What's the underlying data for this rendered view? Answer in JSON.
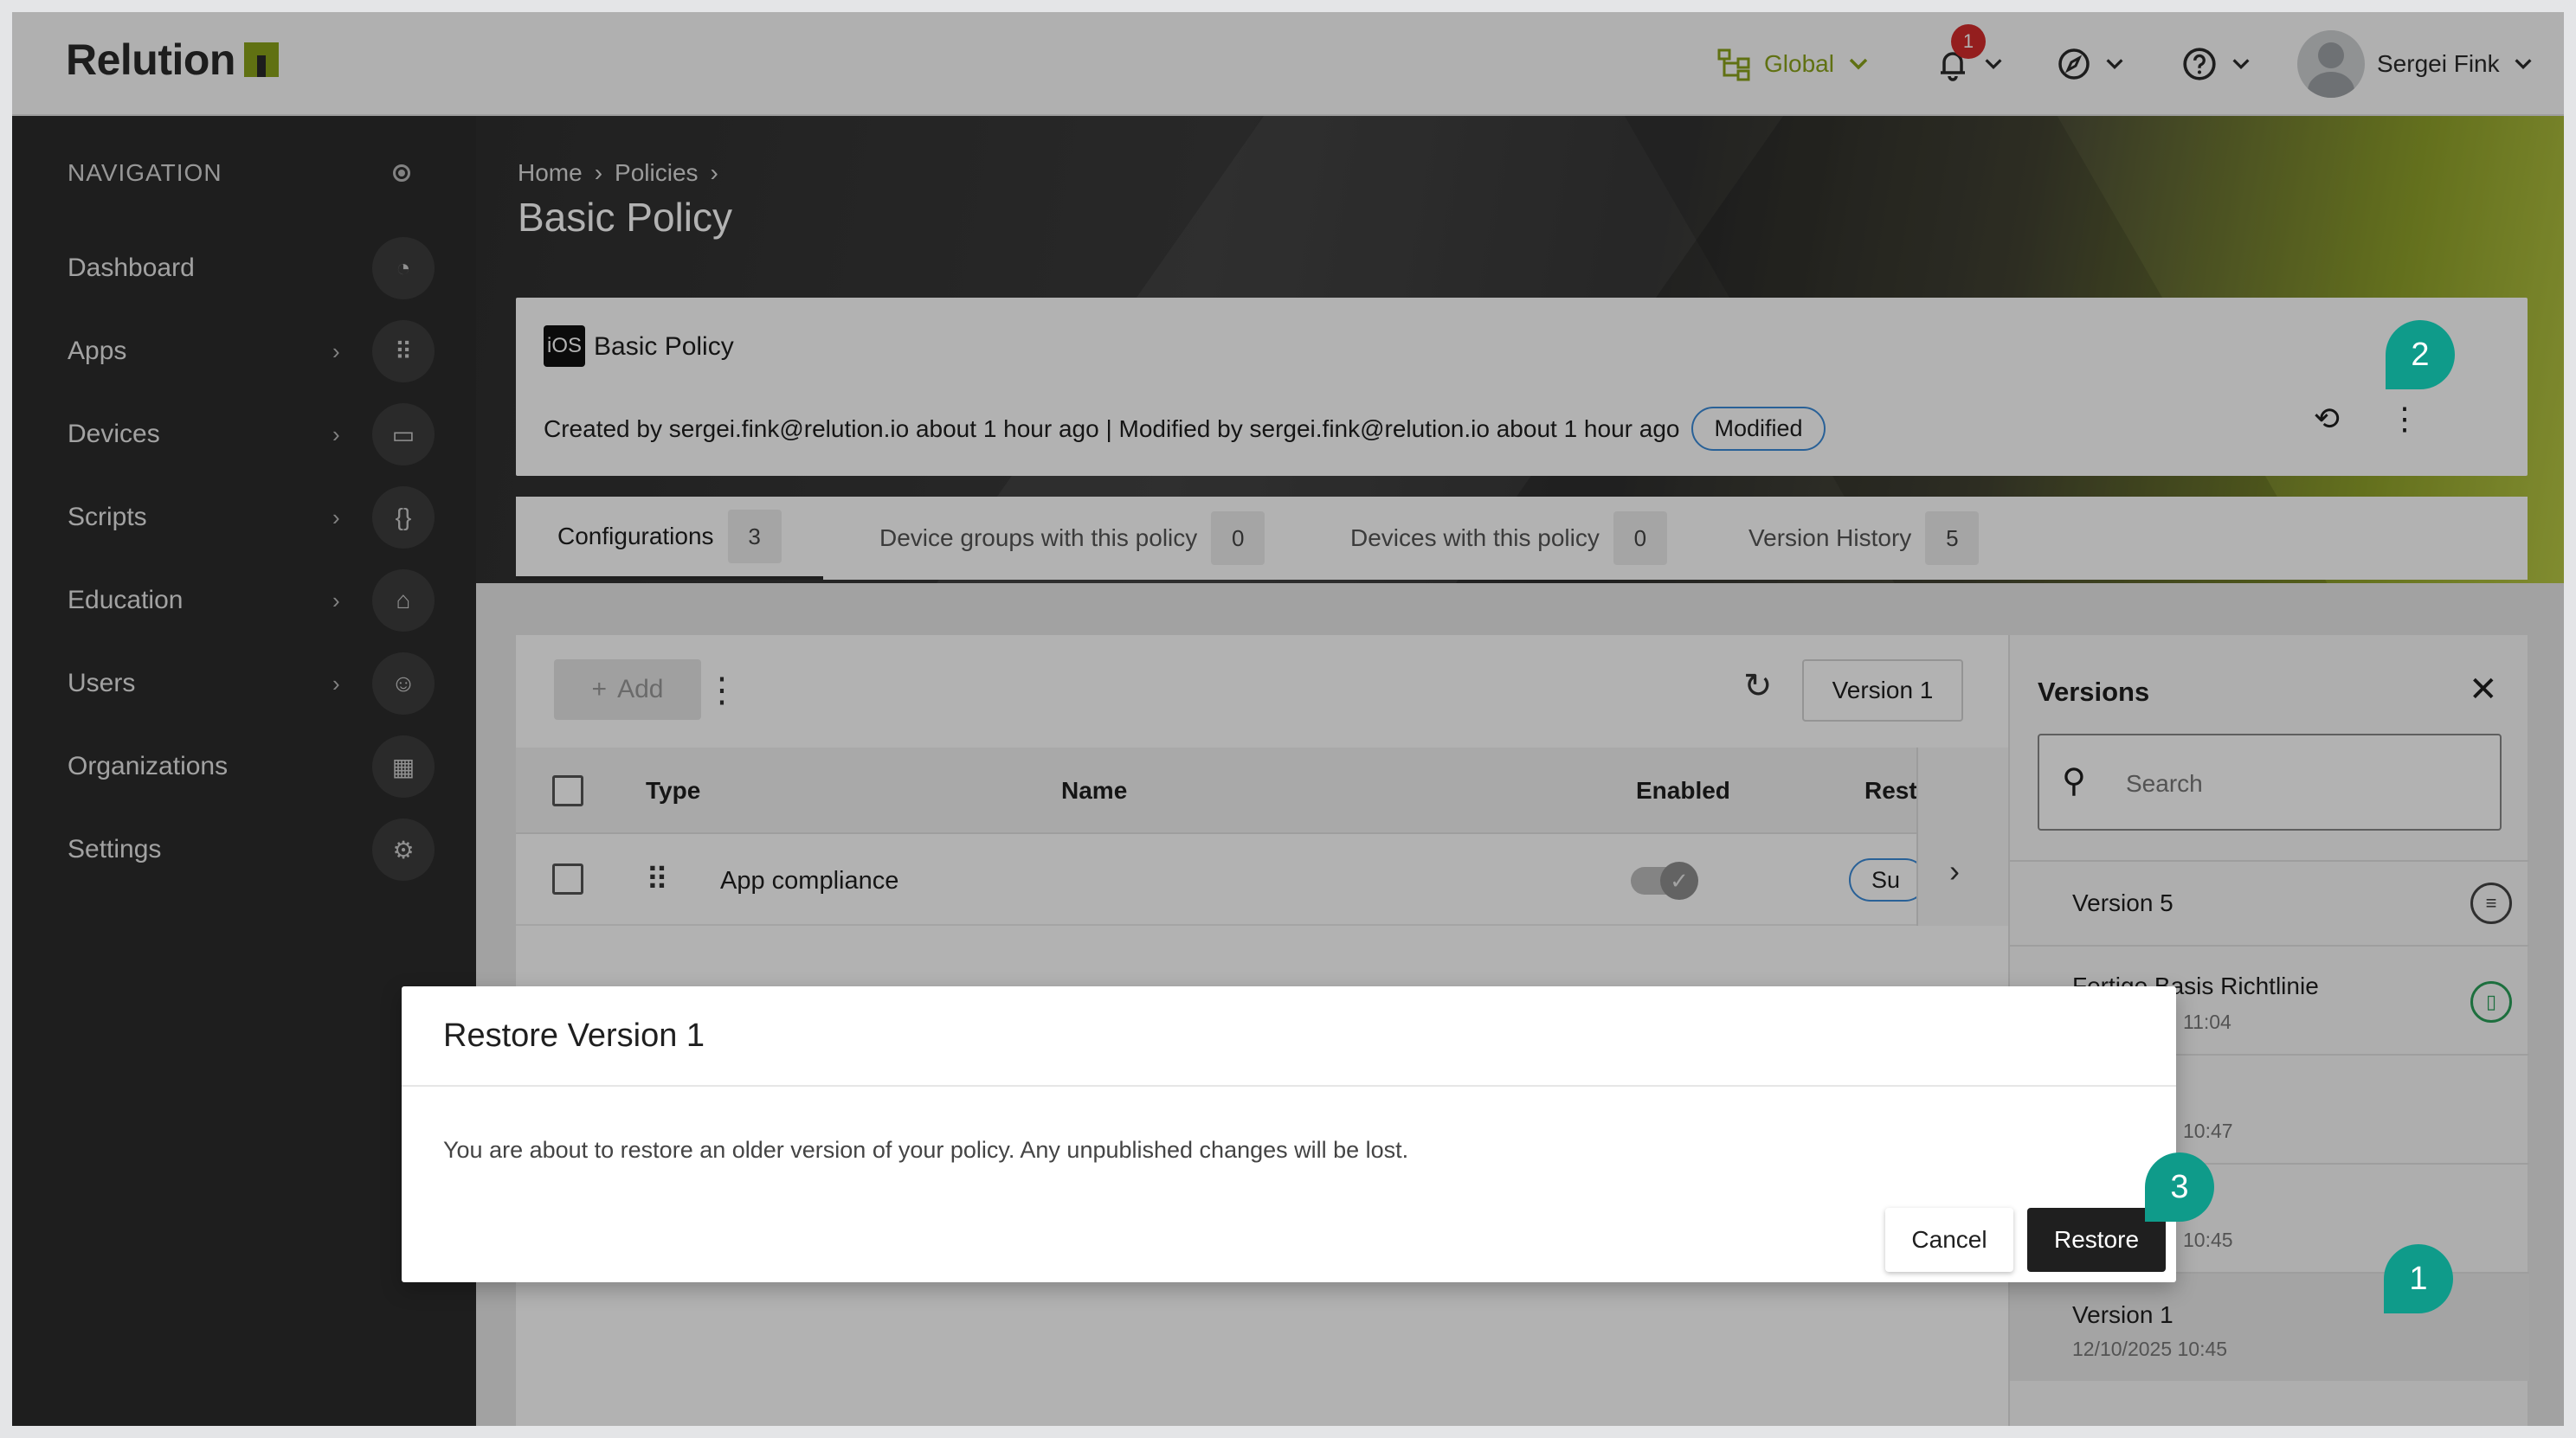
{
  "topbar": {
    "brand": "Relution",
    "scope_label": "Global",
    "notification_count": "1",
    "user_name": "Sergei Fink"
  },
  "sidebar": {
    "heading": "NAVIGATION",
    "items": [
      {
        "label": "Dashboard",
        "icon": "gauge-icon"
      },
      {
        "label": "Apps",
        "icon": "grid-icon"
      },
      {
        "label": "Devices",
        "icon": "devices-icon"
      },
      {
        "label": "Scripts",
        "icon": "braces-icon"
      },
      {
        "label": "Education",
        "icon": "graduation-cap-icon"
      },
      {
        "label": "Users",
        "icon": "user-gear-icon"
      },
      {
        "label": "Organizations",
        "icon": "building-icon"
      },
      {
        "label": "Settings",
        "icon": "gear-icon"
      }
    ]
  },
  "breadcrumb": {
    "home": "Home",
    "policies": "Policies"
  },
  "page_title": "Basic Policy",
  "policy_card": {
    "platform": "iOS",
    "title": "Basic Policy",
    "meta": "Created by sergei.fink@relution.io about 1 hour ago | Modified by sergei.fink@relution.io about 1 hour ago",
    "status": "Modified"
  },
  "tabs": [
    {
      "label": "Configurations",
      "count": "3"
    },
    {
      "label": "Device groups with this policy",
      "count": "0"
    },
    {
      "label": "Devices with this policy",
      "count": "0"
    },
    {
      "label": "Version History",
      "count": "5"
    }
  ],
  "grid": {
    "add_label": "Add",
    "version_label": "Version 1",
    "columns": {
      "type": "Type",
      "name": "Name",
      "enabled": "Enabled",
      "rest": "Rest"
    },
    "rows": [
      {
        "name": "App compliance",
        "status_short": "Su"
      }
    ]
  },
  "versions_panel": {
    "title": "Versions",
    "search_placeholder": "Search",
    "items": [
      {
        "name": "Version 5",
        "date": ""
      },
      {
        "name": "Fertige Basis Richtlinie",
        "date": "11:04"
      },
      {
        "name": "",
        "date": "10:47"
      },
      {
        "name": "",
        "date": "10:45"
      },
      {
        "name": "Version 1",
        "date": "12/10/2025 10:45"
      }
    ]
  },
  "modal": {
    "title": "Restore Version 1",
    "body": "You are about to restore an older version of your policy. Any unpublished changes will be lost.",
    "cancel": "Cancel",
    "restore": "Restore"
  },
  "markers": [
    "1",
    "2",
    "3"
  ],
  "colors": {
    "accent": "#8aa21a",
    "marker": "#0f9b8a",
    "dark": "#2b2b2b"
  }
}
